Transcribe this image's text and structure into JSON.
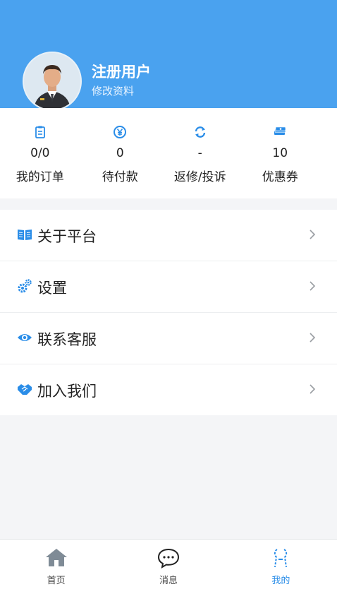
{
  "profile": {
    "name": "注册用户",
    "edit_label": "修改资料",
    "avatar_icon": "user-avatar"
  },
  "stats": [
    {
      "icon": "clipboard-icon",
      "value": "0/0",
      "label": "我的订单"
    },
    {
      "icon": "yen-circle-icon",
      "value": "0",
      "label": "待付款"
    },
    {
      "icon": "refresh-icon",
      "value": "-",
      "label": "返修/投诉"
    },
    {
      "icon": "coupon-stack-icon",
      "value": "10",
      "label": "优惠券"
    }
  ],
  "menu": [
    {
      "icon": "book-icon",
      "label": "关于平台"
    },
    {
      "icon": "gears-icon",
      "label": "设置"
    },
    {
      "icon": "eye-icon",
      "label": "联系客服"
    },
    {
      "icon": "handshake-icon",
      "label": "加入我们"
    }
  ],
  "tabbar": [
    {
      "icon": "home-icon",
      "label": "首页"
    },
    {
      "icon": "chat-icon",
      "label": "消息"
    },
    {
      "icon": "person-icon",
      "label": "我的",
      "active": true
    }
  ],
  "colors": {
    "accent": "#4aa2ef",
    "icon_blue": "#2a8de8",
    "active_tab": "#2a8de8"
  }
}
